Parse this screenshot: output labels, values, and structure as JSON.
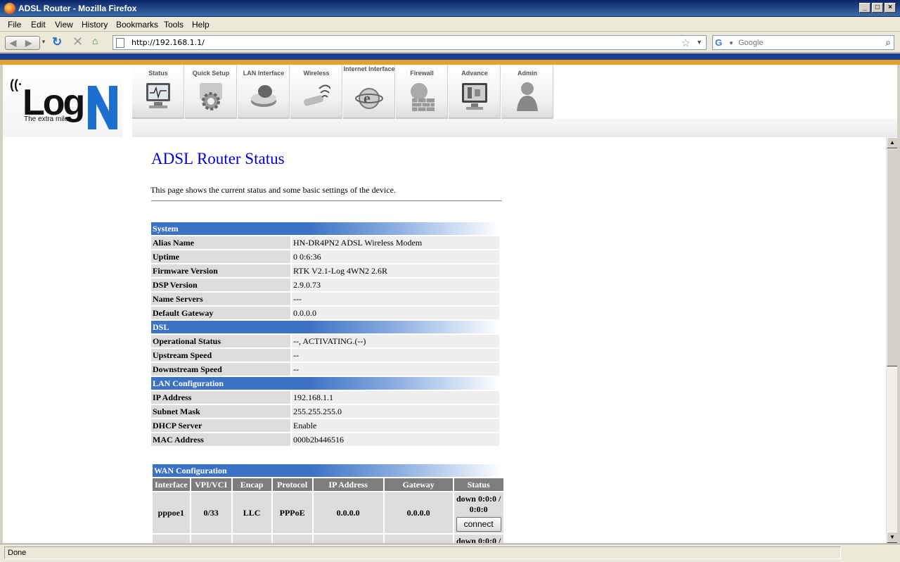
{
  "window": {
    "title": "ADSL Router - Mozilla Firefox"
  },
  "menu": [
    "File",
    "Edit",
    "View",
    "History",
    "Bookmarks",
    "Tools",
    "Help"
  ],
  "address": {
    "url": "http://192.168.1.1/"
  },
  "search": {
    "placeholder": "Google"
  },
  "logo": {
    "text": "Log",
    "tagline": "The extra mile"
  },
  "topnav": [
    {
      "label": "Status",
      "icon": "monitor-icon"
    },
    {
      "label": "Quick Setup",
      "icon": "gear-icon"
    },
    {
      "label": "LAN Interface",
      "icon": "drive-icon"
    },
    {
      "label": "Wireless",
      "icon": "wireless-icon"
    },
    {
      "label": "Internet Interface",
      "icon": "globe-ie-icon"
    },
    {
      "label": "Firewall",
      "icon": "firewall-icon"
    },
    {
      "label": "Advance",
      "icon": "advance-icon"
    },
    {
      "label": "Admin",
      "icon": "user-icon"
    }
  ],
  "page": {
    "title": "ADSL Router Status",
    "description": "This page shows the current status and some basic settings of the device."
  },
  "system": {
    "header": "System",
    "rows": [
      {
        "key": "Alias Name",
        "value": "HN-DR4PN2 ADSL Wireless Modem"
      },
      {
        "key": "Uptime",
        "value": "0 0:6:36"
      },
      {
        "key": "Firmware Version",
        "value": "RTK V2.1-Log 4WN2 2.6R"
      },
      {
        "key": "DSP Version",
        "value": "2.9.0.73"
      },
      {
        "key": "Name Servers",
        "value": "---"
      },
      {
        "key": "Default Gateway",
        "value": "0.0.0.0"
      }
    ]
  },
  "dsl": {
    "header": "DSL",
    "rows": [
      {
        "key": "Operational Status",
        "value": "--, ACTIVATING.(--)"
      },
      {
        "key": "Upstream Speed",
        "value": "--"
      },
      {
        "key": "Downstream Speed",
        "value": "--"
      }
    ]
  },
  "lan": {
    "header": "LAN Configuration",
    "rows": [
      {
        "key": "IP Address",
        "value": "192.168.1.1"
      },
      {
        "key": "Subnet Mask",
        "value": "255.255.255.0"
      },
      {
        "key": "DHCP Server",
        "value": "Enable"
      },
      {
        "key": "MAC Address",
        "value": "000b2b446516"
      }
    ]
  },
  "wan": {
    "header": "WAN Configuration",
    "columns": [
      "Interface",
      "VPI/VCI",
      "Encap",
      "Protocol",
      "IP Address",
      "Gateway",
      "Status"
    ],
    "rows": [
      {
        "interface": "pppoe1",
        "vpivci": "0/33",
        "encap": "LLC",
        "protocol": "PPPoE",
        "ip": "0.0.0.0",
        "gateway": "0.0.0.0",
        "status": "down 0:0:0 / 0:0:0",
        "action": "connect"
      },
      {
        "interface": "",
        "vpivci": "",
        "encap": "",
        "protocol": "",
        "ip": "",
        "gateway": "",
        "status": "down 0:0:0 /",
        "action": ""
      }
    ]
  },
  "statusbar": {
    "text": "Done"
  }
}
